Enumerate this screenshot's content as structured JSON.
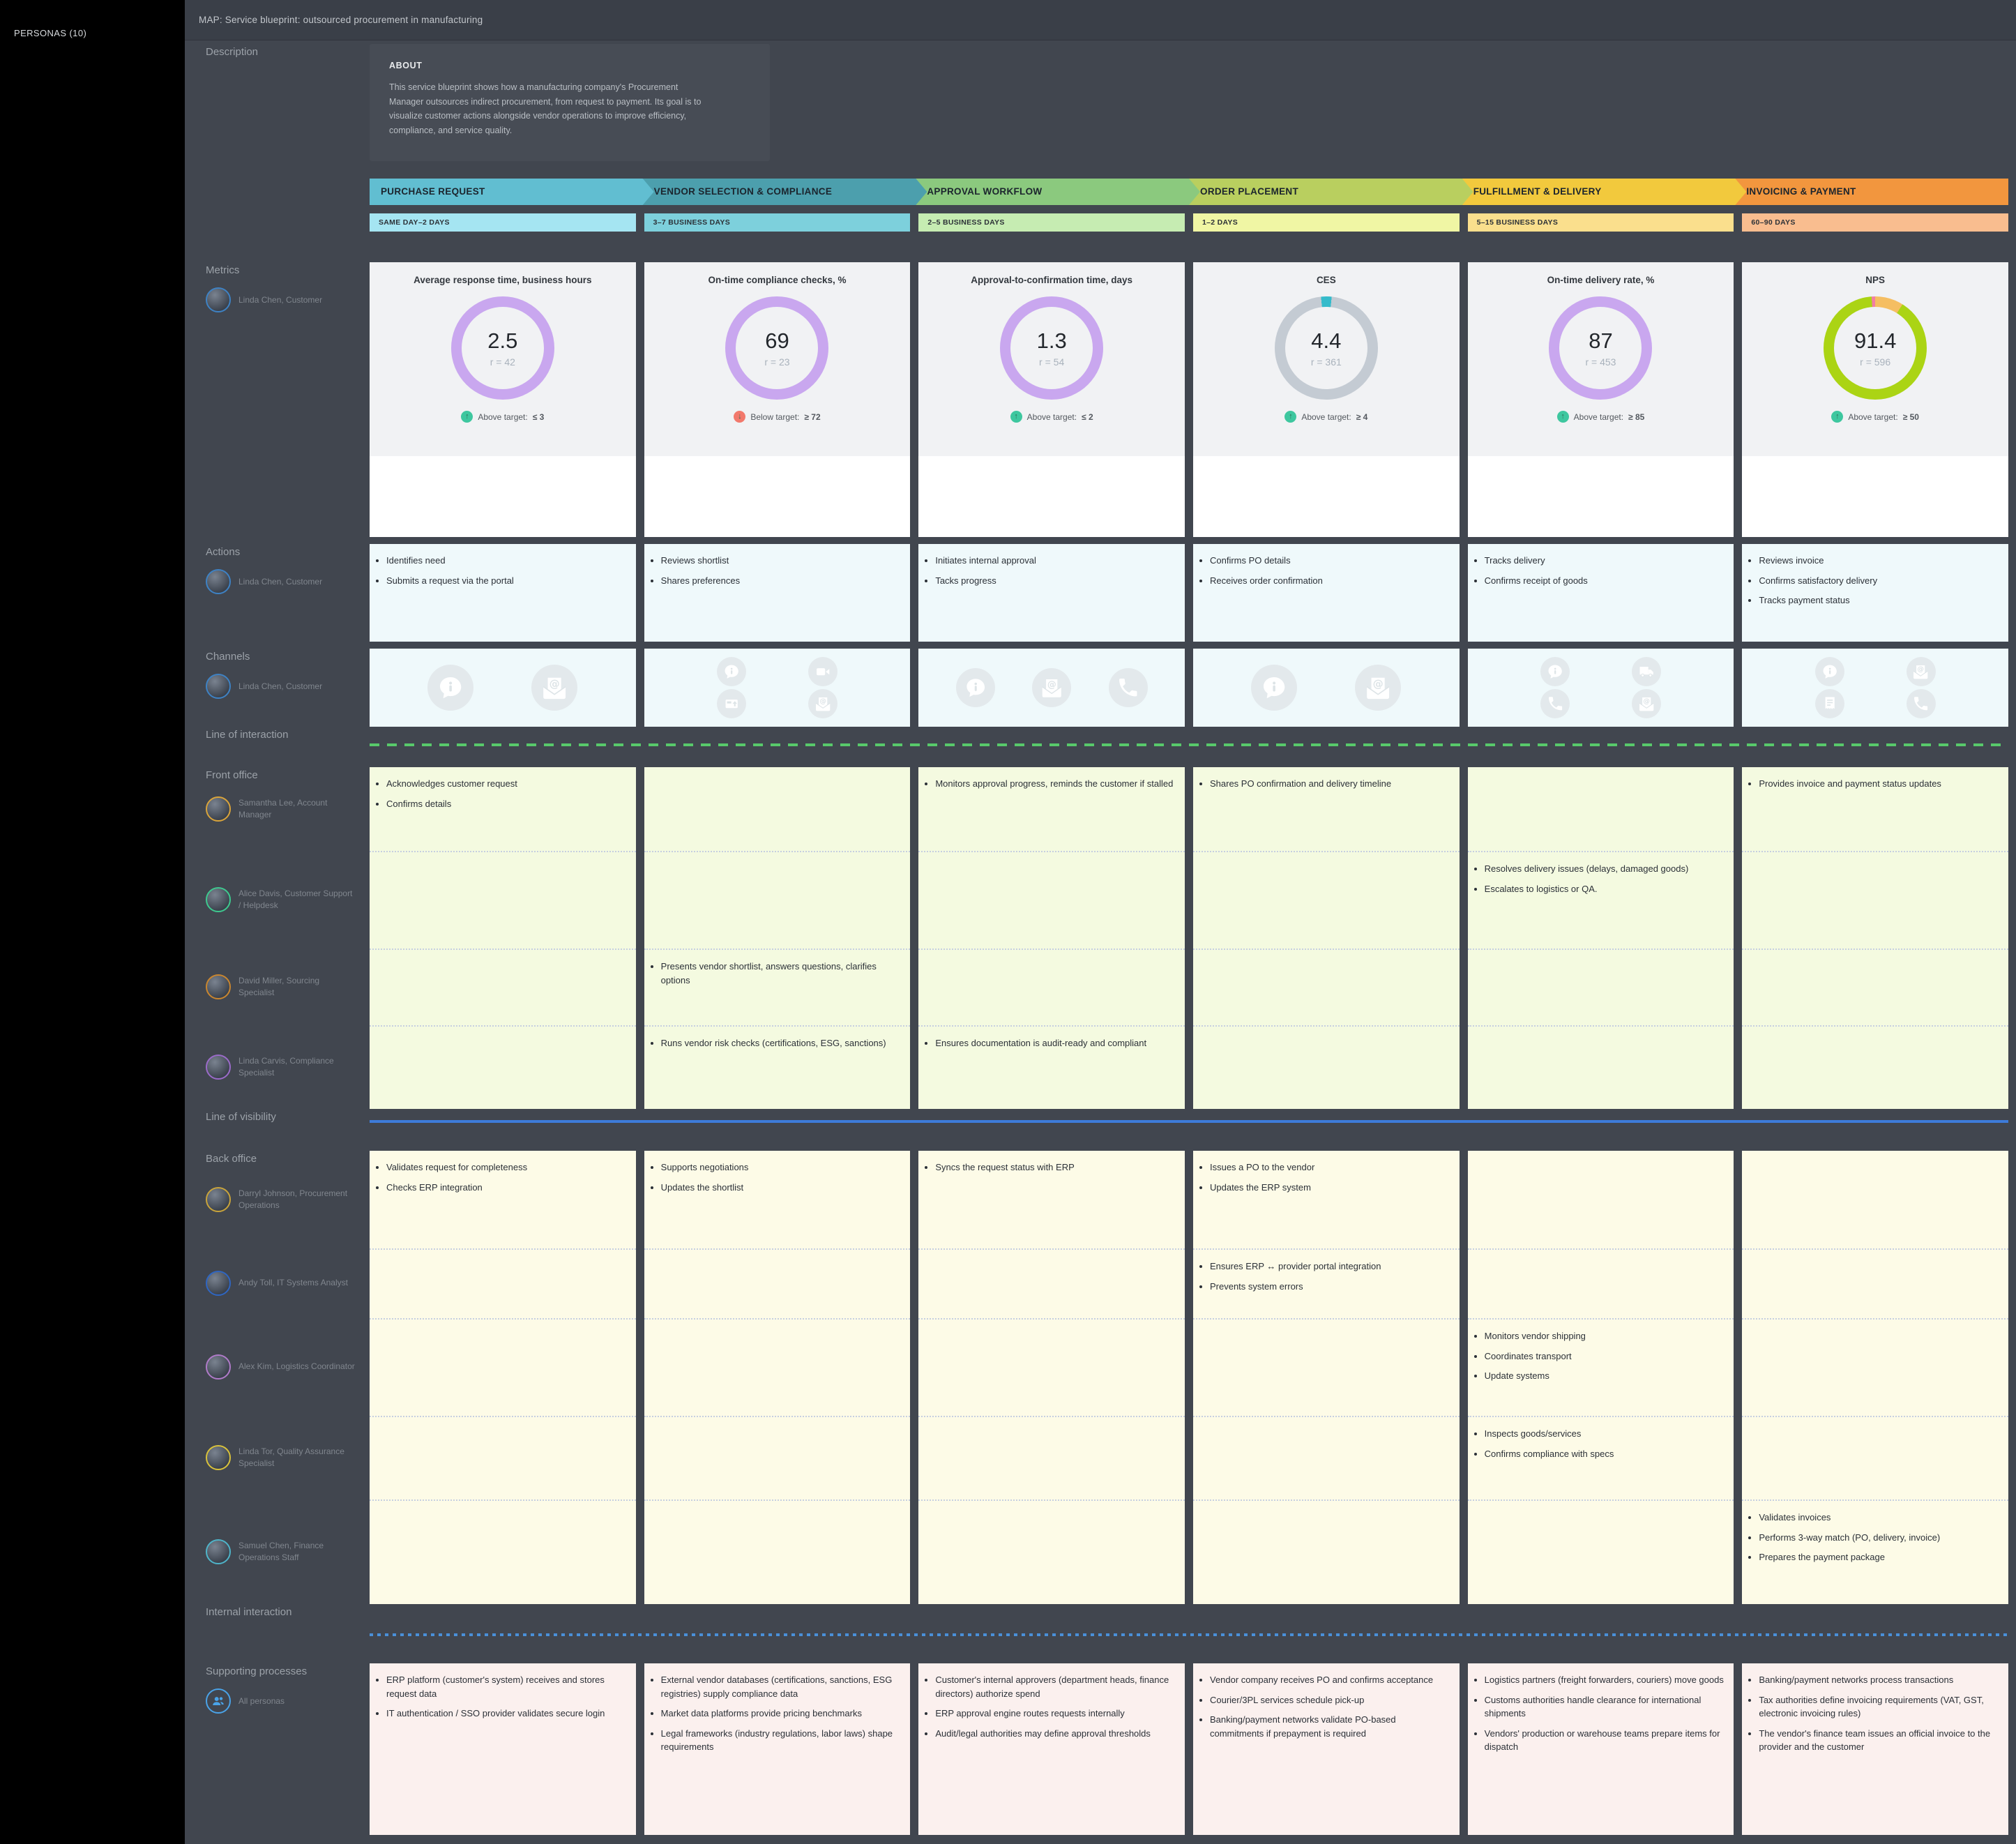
{
  "sidebar": {
    "title": "PERSONAS (10)"
  },
  "header": {
    "title": "MAP: Service blueprint: outsourced procurement in manufacturing"
  },
  "rows": {
    "description_label": "Description",
    "metrics_label": "Metrics",
    "actions_label": "Actions",
    "channels_label": "Channels",
    "front_office_label": "Front office",
    "back_office_label": "Back office",
    "supporting_label": "Supporting processes"
  },
  "about": {
    "title": "ABOUT",
    "body": "This service blueprint shows how a manufacturing company's Procurement Manager outsources indirect procurement, from request to payment. Its goal is to visualize customer actions alongside vendor operations to improve efficiency, compliance, and service quality."
  },
  "lines": {
    "interaction": {
      "label": "Line of interaction",
      "color": "#58C96B"
    },
    "visibility": {
      "label": "Line of visibility",
      "color": "#3D7BD9"
    },
    "internal": {
      "label": "Internal interaction",
      "color": "#4A90D9"
    }
  },
  "stages": [
    {
      "name": "PURCHASE REQUEST",
      "duration": "SAME DAY–2 DAYS",
      "arrow_color": "#61BED1",
      "duration_color": "#A5E5F2"
    },
    {
      "name": "VENDOR SELECTION & COMPLIANCE",
      "duration": "3–7 BUSINESS DAYS",
      "arrow_color": "#4C9FAD",
      "duration_color": "#7DD0DC"
    },
    {
      "name": "APPROVAL WORKFLOW",
      "duration": "2–5 BUSINESS DAYS",
      "arrow_color": "#8BC97E",
      "duration_color": "#C6ECB2"
    },
    {
      "name": "ORDER PLACEMENT",
      "duration": "1–2 DAYS",
      "arrow_color": "#B9CF5F",
      "duration_color": "#F0F6A4"
    },
    {
      "name": "FULFILLMENT & DELIVERY",
      "duration": "5–15 BUSINESS DAYS",
      "arrow_color": "#F2C93D",
      "duration_color": "#FADF8D"
    },
    {
      "name": "INVOICING & PAYMENT",
      "duration": "60–90 DAYS",
      "arrow_color": "#F2963E",
      "duration_color": "#F9BD8F"
    }
  ],
  "metrics": [
    {
      "title": "Average response time, business hours",
      "value": "2.5",
      "r": "r = 42",
      "target_prefix": "Above target:",
      "target_value": "≤ 3",
      "badge": "up",
      "ring": "#C9A7EF"
    },
    {
      "title": "On-time compliance checks, %",
      "value": "69",
      "r": "r = 23",
      "target_prefix": "Below target:",
      "target_value": "≥ 72",
      "badge": "down",
      "ring": "#C9A7EF"
    },
    {
      "title": "Approval-to-confirmation time, days",
      "value": "1.3",
      "r": "r = 54",
      "target_prefix": "Above target:",
      "target_value": "≤ 2",
      "badge": "up",
      "ring": "#C9A7EF"
    },
    {
      "title": "CES",
      "value": "4.4",
      "r": "r = 361",
      "target_prefix": "Above target:",
      "target_value": "≥ 4",
      "badge": "up",
      "ring": "conic-gradient(#35BBCB 0deg 6deg, #C4CBD3 6deg 354deg, #35BBCB 354deg 360deg)"
    },
    {
      "title": "On-time delivery rate, %",
      "value": "87",
      "r": "r = 453",
      "target_prefix": "Above target:",
      "target_value": "≥ 85",
      "badge": "up",
      "ring": "#C9A7EF"
    },
    {
      "title": "NPS",
      "value": "91.4",
      "r": "r = 596",
      "target_prefix": "Above target:",
      "target_value": "≥ 50",
      "badge": "up",
      "ring": "conic-gradient(#F5BE62 0deg 32deg, #ABD414 32deg 356deg, #F27DA5 356deg 360deg)"
    }
  ],
  "badge_colors": {
    "up": "#3EC79F",
    "down": "#F2796C"
  },
  "personas": {
    "customer": {
      "label": "Linda Chen, Customer",
      "ring": "#3E82C4"
    },
    "front_office": [
      {
        "label": "Samantha Lee, Account Manager",
        "ring": "#D9A43B"
      },
      {
        "label": "Alice Davis, Customer Support / Helpdesk",
        "ring": "#3EC98F"
      },
      {
        "label": "David Miller, Sourcing Specialist",
        "ring": "#C9862F"
      },
      {
        "label": "Linda Carvis, Compliance Specialist",
        "ring": "#9B6BC9"
      }
    ],
    "back_office": [
      {
        "label": "Darryl Johnson, Procurement Operations",
        "ring": "#C9A43B"
      },
      {
        "label": "Andy Toll, IT Systems Analyst",
        "ring": "#2F66C2"
      },
      {
        "label": "Alex Kim, Logistics Coordinator",
        "ring": "#B07BC9"
      },
      {
        "label": "Linda Tor, Quality Assurance Specialist",
        "ring": "#D9C23B"
      },
      {
        "label": "Samuel Chen, Finance Operations Staff",
        "ring": "#4FB4C9"
      }
    ],
    "all_personas_label": "All personas"
  },
  "actions": {
    "cells": [
      [
        "Identifies need",
        "Submits a request via the portal"
      ],
      [
        "Reviews shortlist",
        "Shares preferences"
      ],
      [
        "Initiates internal approval",
        "Tacks progress"
      ],
      [
        "Confirms PO details",
        "Receives order confirmation"
      ],
      [
        "Tracks delivery",
        "Confirms receipt of goods"
      ],
      [
        "Reviews invoice",
        "Confirms satisfactory delivery",
        "Tracks payment status"
      ]
    ]
  },
  "channels": {
    "cells": [
      {
        "layout": "big2",
        "icons": [
          "chat-info",
          "email"
        ]
      },
      {
        "layout": "grid4",
        "icons": [
          "chat-info",
          "video",
          "portal",
          "email"
        ]
      },
      {
        "layout": "row3",
        "icons": [
          "chat-info",
          "email",
          "phone"
        ]
      },
      {
        "layout": "big2",
        "icons": [
          "chat-info",
          "email"
        ]
      },
      {
        "layout": "grid4",
        "icons": [
          "chat-info",
          "truck",
          "phone",
          "email"
        ]
      },
      {
        "layout": "grid4",
        "icons": [
          "chat-info",
          "email",
          "receipt",
          "phone"
        ]
      }
    ]
  },
  "front_office": {
    "rows": [
      {
        "cells": [
          [
            "Acknowledges customer request",
            "Confirms details"
          ],
          [],
          [
            "Monitors approval progress, reminds the customer if stalled"
          ],
          [
            "Shares PO confirmation and delivery timeline"
          ],
          [],
          [
            "Provides invoice and payment status updates"
          ]
        ]
      },
      {
        "cells": [
          [],
          [],
          [],
          [],
          [
            "Resolves delivery issues (delays, damaged goods)",
            "Escalates to logistics or QA."
          ],
          []
        ]
      },
      {
        "cells": [
          [],
          [
            "Presents vendor shortlist, answers questions, clarifies options"
          ],
          [],
          [],
          [],
          []
        ]
      },
      {
        "cells": [
          [],
          [
            "Runs vendor risk checks (certifications, ESG, sanctions)"
          ],
          [
            "Ensures documentation is audit-ready and compliant"
          ],
          [],
          [],
          []
        ]
      }
    ]
  },
  "back_office": {
    "rows": [
      {
        "cells": [
          [
            "Validates request for completeness",
            "Checks ERP integration"
          ],
          [
            "Supports negotiations",
            "Updates the shortlist"
          ],
          [
            "Syncs the request status with ERP"
          ],
          [
            "Issues a PO to the vendor",
            "Updates the ERP system"
          ],
          [],
          []
        ]
      },
      {
        "cells": [
          [],
          [],
          [],
          [
            "Ensures ERP ↔ provider portal integration",
            "Prevents system errors"
          ],
          [],
          []
        ]
      },
      {
        "cells": [
          [],
          [],
          [],
          [],
          [
            "Monitors vendor shipping",
            "Coordinates transport",
            "Update systems"
          ],
          []
        ]
      },
      {
        "cells": [
          [],
          [],
          [],
          [],
          [
            "Inspects goods/services",
            "Confirms compliance with specs"
          ],
          []
        ]
      },
      {
        "cells": [
          [],
          [],
          [],
          [],
          [],
          [
            "Validates invoices",
            "Performs 3-way match (PO, delivery, invoice)",
            "Prepares the payment package"
          ]
        ]
      }
    ]
  },
  "supporting": {
    "cells": [
      [
        "ERP platform (customer's system) receives and stores request data",
        "IT authentication / SSO provider validates secure login"
      ],
      [
        "External vendor databases (certifications, sanctions, ESG registries) supply compliance data",
        "Market data platforms provide pricing benchmarks",
        "Legal frameworks (industry regulations, labor laws) shape requirements"
      ],
      [
        "Customer's internal approvers (department heads, finance directors) authorize spend",
        "ERP approval engine routes requests internally",
        "Audit/legal authorities may define approval thresholds"
      ],
      [
        "Vendor company receives PO and confirms acceptance",
        "Courier/3PL services schedule pick-up",
        "Banking/payment networks validate PO-based commitments if prepayment is required"
      ],
      [
        "Logistics partners (freight forwarders, couriers) move goods",
        "Customs authorities handle clearance for international shipments",
        "Vendors' production or warehouse teams prepare items for dispatch"
      ],
      [
        "Banking/payment networks process transactions",
        "Tax authorities define invoicing requirements (VAT, GST, electronic invoicing rules)",
        "The vendor's finance team issues an official invoice to the provider and the customer"
      ]
    ]
  }
}
